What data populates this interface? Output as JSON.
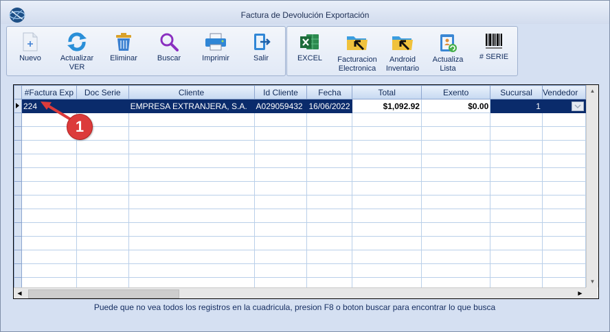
{
  "window": {
    "title": "Factura de Devolución  Exportación"
  },
  "toolbar": {
    "primary": [
      {
        "id": "nuevo",
        "label": "Nuevo",
        "icon": "new-document-icon"
      },
      {
        "id": "actualizar",
        "label": "Actualizar\nVER",
        "icon": "refresh-icon"
      },
      {
        "id": "eliminar",
        "label": "Eliminar",
        "icon": "trash-icon"
      },
      {
        "id": "buscar",
        "label": "Buscar",
        "icon": "search-icon"
      },
      {
        "id": "imprimir",
        "label": "Imprimir",
        "icon": "printer-icon"
      },
      {
        "id": "salir",
        "label": "Salir",
        "icon": "exit-icon"
      }
    ],
    "secondary": [
      {
        "id": "excel",
        "label": "EXCEL",
        "icon": "excel-icon"
      },
      {
        "id": "facturacion",
        "label": "Facturacion\nElectronica",
        "icon": "folder-arrow-icon"
      },
      {
        "id": "android",
        "label": "Android\nInventario",
        "icon": "folder-arrow-icon"
      },
      {
        "id": "actualiza_lista",
        "label": "Actualiza\nLista",
        "icon": "clipboard-refresh-icon"
      },
      {
        "id": "serie",
        "label": "# SERIE",
        "icon": "barcode-icon"
      }
    ]
  },
  "grid": {
    "columns": [
      "#Factura Exp",
      "Doc Serie",
      "Cliente",
      "Id Cliente",
      "Fecha",
      "Total",
      "Exento",
      "Sucursal",
      "Vendedor"
    ],
    "rows": [
      {
        "factura": "224",
        "doc_serie": "",
        "cliente": "EMPRESA EXTRANJERA, S.A.",
        "id_cliente": "A029059432",
        "fecha": "16/06/2022",
        "total": "$1,092.92",
        "exento": "$0.00",
        "sucursal": "1",
        "vendedor": ""
      }
    ],
    "empty_rows": 13
  },
  "hint": "Puede que no vea todos los registros en la cuadricula, presion F8 o boton buscar para encontrar lo que busca",
  "annotation": {
    "label": "1",
    "color": "#dc3b3b"
  },
  "colors": {
    "selected_row": "#0a2b6b",
    "window_bg": "#d5e0f2",
    "header_text": "#102a58"
  }
}
